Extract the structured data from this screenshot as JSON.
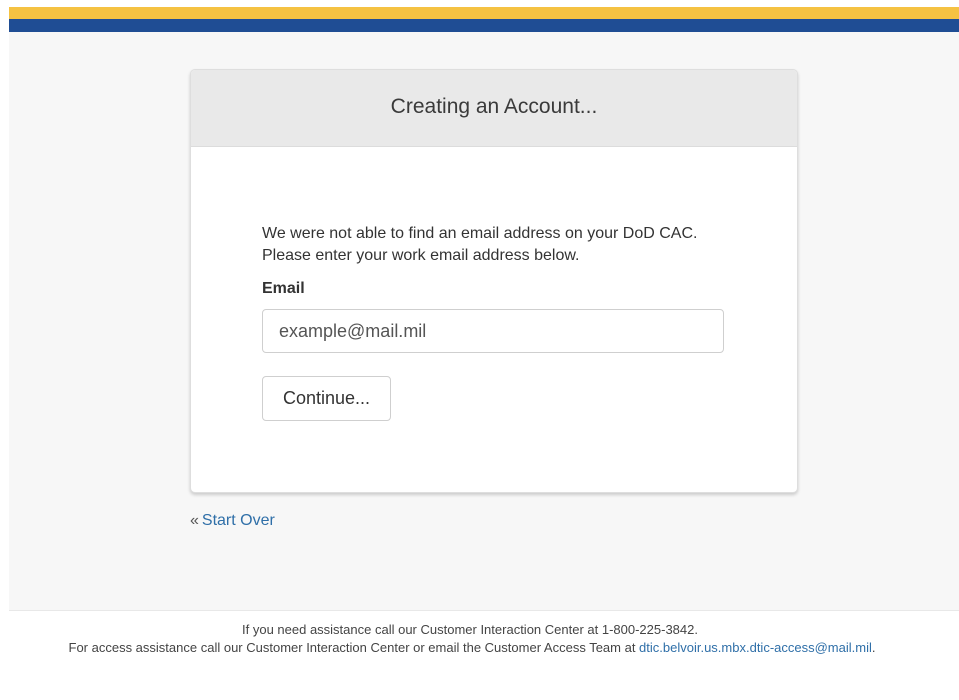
{
  "card": {
    "title": "Creating an Account...",
    "message": "We were not able to find an email address on your DoD CAC. Please enter your work email address below.",
    "email_label": "Email",
    "email_placeholder": "example@mail.mil",
    "continue_label": "Continue..."
  },
  "nav": {
    "start_over_prefix": "«",
    "start_over_label": "Start Over"
  },
  "footer": {
    "line1": "If you need assistance call our Customer Interaction Center at 1-800-225-3842.",
    "line2_prefix": "For access assistance call our Customer Interaction Center or email the Customer Access Team at ",
    "email": "dtic.belvoir.us.mbx.dtic-access@mail.mil",
    "line2_suffix": "."
  },
  "colors": {
    "top_band_gold": "#f5c242",
    "top_band_blue": "#1f4d94",
    "link": "#2f6fa8",
    "card_header": "#e9e9e9"
  }
}
